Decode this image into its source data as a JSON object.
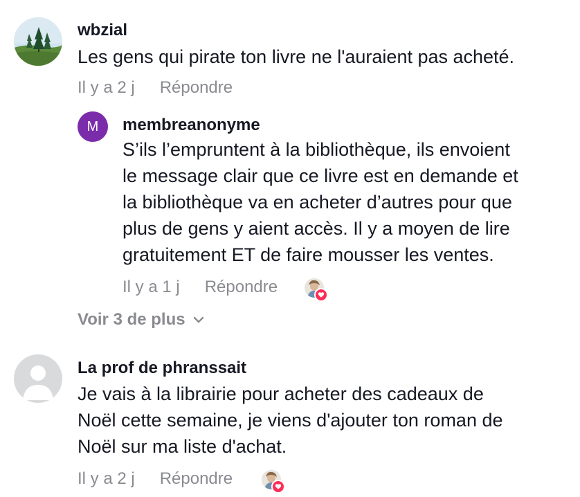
{
  "comments": [
    {
      "username": "wbzial",
      "text": "Les gens qui pirate ton livre ne l'auraient pas acheté.",
      "time": "Il y a 2 j",
      "reply_label": "Répondre",
      "avatar_type": "landscape-photo",
      "replies": [
        {
          "username": "membreanonyme",
          "avatar_initial": "M",
          "avatar_color": "#7b2cab",
          "text_lines": [
            "S’ils l’empruntent à la bibliothèque, ils envoient",
            "le message clair que ce livre est en demande et",
            "la bibliothèque va en acheter d’autres pour que",
            "plus de gens y aient accès. Il y a moyen de lire",
            "gratuitement ET de faire mousser les ventes."
          ],
          "time": "Il y a 1 j",
          "reply_label": "Répondre",
          "liked_by_creator": true
        }
      ],
      "see_more_label": "Voir 3 de plus"
    },
    {
      "username": "La prof de phranssait",
      "text_lines": [
        "Je vais à la librairie pour acheter des cadeaux de",
        "Noël cette semaine, je viens d'ajouter ton roman de",
        "Noël sur ma liste d'achat."
      ],
      "time": "Il y a 2 j",
      "reply_label": "Répondre",
      "avatar_type": "default-placeholder",
      "liked_by_creator": true
    }
  ],
  "colors": {
    "primary_text": "#161823",
    "secondary_text": "#8a8b91",
    "heart": "#fe2c55"
  },
  "icons": {
    "chevron": "chevron-down-icon",
    "heart": "heart-icon"
  }
}
